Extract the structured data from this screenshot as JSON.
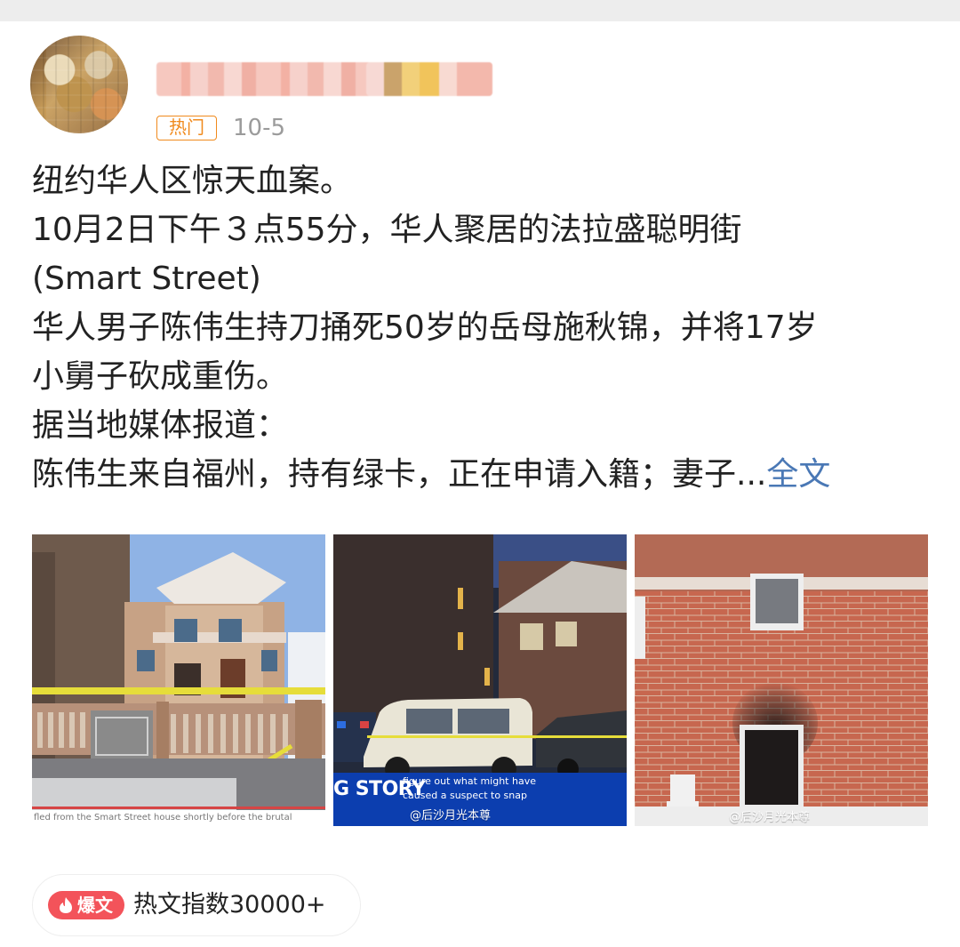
{
  "post": {
    "hot_tag": "热门",
    "date": "10-5",
    "lines": [
      "纽约华人区惊天血案。",
      "10月2日下午３点55分，华人聚居的法拉盛聪明街",
      "(Smart Street)",
      "华人男子陈伟生持刀捅死50岁的岳母施秋锦，并将17岁",
      "小舅子砍成重伤。",
      "据当地媒体报道：",
      "陈伟生来自福州，持有绿卡，正在申请入籍；妻子..."
    ],
    "full_text_link": "全文"
  },
  "photos": [
    {
      "caption": "fled from the Smart Street house shortly before the brutal knifing."
    },
    {
      "tv_main": "G STORY",
      "tv_sub1": "figure out what might have",
      "tv_sub2": "caused a suspect to snap",
      "watermark": "@后沙月光本尊"
    },
    {
      "watermark": "@后沙月光本尊"
    }
  ],
  "badge": {
    "burst_label": "爆文",
    "hot_index": "热文指数30000+"
  },
  "colors": {
    "accent_orange": "#f08a1d",
    "link_blue": "#4a78b5",
    "burst_red": "#f3535a"
  }
}
